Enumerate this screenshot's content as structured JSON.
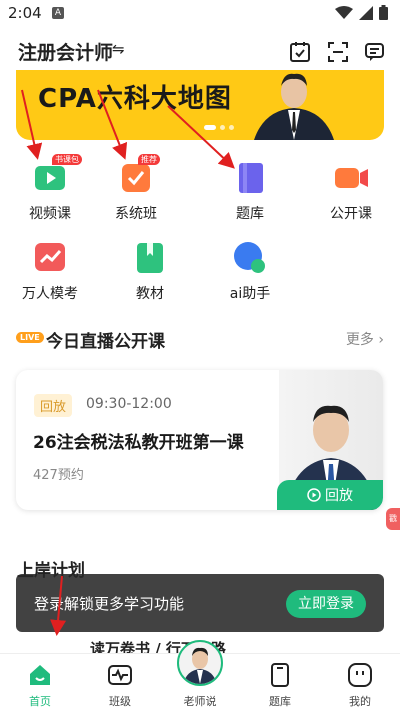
{
  "status": {
    "time": "2:04",
    "a_badge": "A"
  },
  "header": {
    "title": "注册会计师",
    "switch_glyph": "⇋"
  },
  "banner": {
    "text": "CPA六科大地图",
    "color": "#ffc915"
  },
  "grid": [
    {
      "label": "视频课",
      "tag": "书课包",
      "icon": "video-icon",
      "color": "#2ec27e"
    },
    {
      "label": "系统班",
      "tag": "推荐",
      "icon": "checklist-icon",
      "color": "#ff7a3c"
    },
    {
      "label": "题库",
      "tag": "",
      "icon": "question-bank-icon",
      "color": "#6b63ec"
    },
    {
      "label": "公开课",
      "tag": "",
      "icon": "camera-icon",
      "color": "#ff7a3c"
    },
    {
      "label": "万人模考",
      "tag": "",
      "icon": "trend-chart-icon",
      "color": "#f25a5a"
    },
    {
      "label": "教材",
      "tag": "",
      "icon": "textbook-icon",
      "color": "#2ec27e"
    },
    {
      "label": "ai助手",
      "tag": "",
      "icon": "ai-assistant-icon",
      "color": "#3a7bf0"
    }
  ],
  "live": {
    "badge": "LIVE",
    "title": "今日直播公开课",
    "more": "更多",
    "card": {
      "tag": "回放",
      "time": "09:30-12:00",
      "title": "26注会税法私教开班第一课",
      "count": "427预约",
      "button": "回放"
    }
  },
  "side_tab": "戳",
  "plan": {
    "title": "上岸计划",
    "book_text": "读万卷书 / 行万里路"
  },
  "toast": {
    "text": "登录解锁更多学习功能",
    "button": "立即登录"
  },
  "nav": [
    {
      "label": "首页",
      "active": true
    },
    {
      "label": "班级",
      "active": false
    },
    {
      "label": "老师说",
      "active": false
    },
    {
      "label": "题库",
      "active": false
    },
    {
      "label": "我的",
      "active": false
    }
  ],
  "accent": "#1fbb7d"
}
